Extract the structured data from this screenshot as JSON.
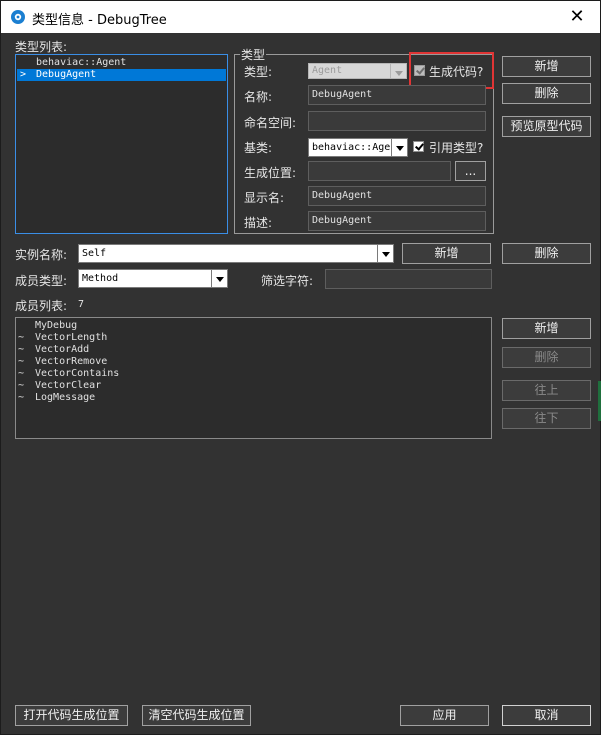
{
  "window": {
    "title": "类型信息 - DebugTree",
    "close_glyph": "✕"
  },
  "type_list": {
    "label": "类型列表:",
    "items": [
      "behaviac::Agent",
      "DebugAgent"
    ],
    "selected_marker": ">",
    "selected_index": 1
  },
  "type_group": {
    "label": "类型",
    "type_label": "类型:",
    "type_value": "Agent",
    "generate_code_label": "生成代码?",
    "name_label": "名称:",
    "name_value": "DebugAgent",
    "namespace_label": "命名空间:",
    "namespace_value": "",
    "base_label": "基类:",
    "base_value": "behaviac::Age",
    "ref_type_label": "引用类型?",
    "gen_location_label": "生成位置:",
    "gen_location_value": "",
    "browse_label": "...",
    "display_name_label": "显示名:",
    "display_name_value": "DebugAgent",
    "description_label": "描述:",
    "description_value": "DebugAgent"
  },
  "right_buttons": {
    "new": "新增",
    "delete": "删除",
    "preview": "预览原型代码"
  },
  "instance": {
    "label": "实例名称:",
    "value": "Self",
    "new": "新增",
    "delete": "删除"
  },
  "member": {
    "type_label": "成员类型:",
    "type_value": "Method",
    "filter_label": "筛选字符:",
    "filter_value": "",
    "list_label": "成员列表:",
    "count": "7",
    "items": [
      {
        "prefix": "",
        "name": "MyDebug"
      },
      {
        "prefix": "~",
        "name": "VectorLength"
      },
      {
        "prefix": "~",
        "name": "VectorAdd"
      },
      {
        "prefix": "~",
        "name": "VectorRemove"
      },
      {
        "prefix": "~",
        "name": "VectorContains"
      },
      {
        "prefix": "~",
        "name": "VectorClear"
      },
      {
        "prefix": "~",
        "name": "LogMessage"
      }
    ],
    "buttons": {
      "new": "新增",
      "delete": "删除",
      "up": "往上",
      "down": "往下"
    }
  },
  "footer": {
    "open_location": "打开代码生成位置",
    "clear_location": "清空代码生成位置",
    "apply": "应用",
    "cancel": "取消"
  },
  "colors": {
    "window_bg": "#323232",
    "selection": "#0078d7",
    "highlight_border": "#e03535"
  }
}
